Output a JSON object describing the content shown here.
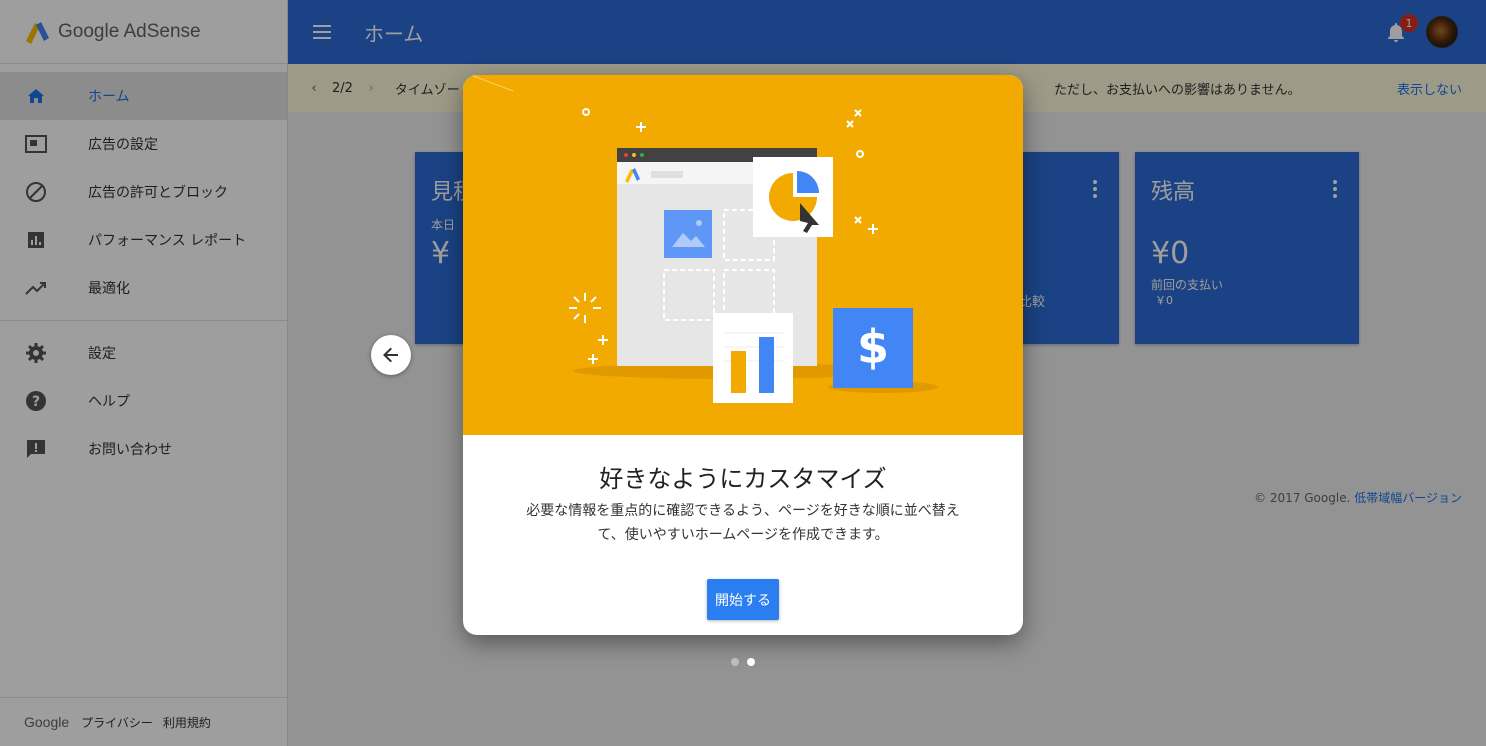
{
  "app": {
    "brand": "Google AdSense"
  },
  "sidebar": {
    "items": [
      {
        "label": "ホーム",
        "icon": "home-icon"
      },
      {
        "label": "広告の設定",
        "icon": "ad-settings-icon"
      },
      {
        "label": "広告の許可とブロック",
        "icon": "block-icon"
      },
      {
        "label": "パフォーマンス レポート",
        "icon": "bar-chart-icon"
      },
      {
        "label": "最適化",
        "icon": "trending-up-icon"
      },
      {
        "label": "設定",
        "icon": "gear-icon"
      },
      {
        "label": "ヘルプ",
        "icon": "help-icon"
      },
      {
        "label": "お問い合わせ",
        "icon": "feedback-icon"
      }
    ],
    "footer": {
      "google": "Google",
      "privacy": "プライバシー",
      "terms": "利用規約"
    }
  },
  "header": {
    "title": "ホーム",
    "notification_count": "1"
  },
  "banner": {
    "pager": "2/2",
    "message_start": "タイムゾー",
    "message_end": "ただし、お支払いへの影響はありません。",
    "dismiss": "表示しない"
  },
  "cards": {
    "estimate": {
      "title": "見積",
      "sub": "本日",
      "value": "¥"
    },
    "third": {
      "compare": "比較"
    },
    "balance": {
      "title": "残高",
      "value": "¥0",
      "sub": "前回の支払い",
      "sub_value": "￥0"
    }
  },
  "footer": {
    "copyright": "© 2017 Google.",
    "lowband": "低帯域幅バージョン"
  },
  "dialog": {
    "title": "好きなようにカスタマイズ",
    "body": "必要な情報を重点的に確認できるよう、ページを好きな順に並べ替えて、使いやすいホームページを作成できます。",
    "button": "開始する",
    "page_dots": 2,
    "active_dot": 2
  },
  "colors": {
    "primary": "#2a6bd5",
    "accent": "#f2a900",
    "button": "#2a7ef0"
  }
}
